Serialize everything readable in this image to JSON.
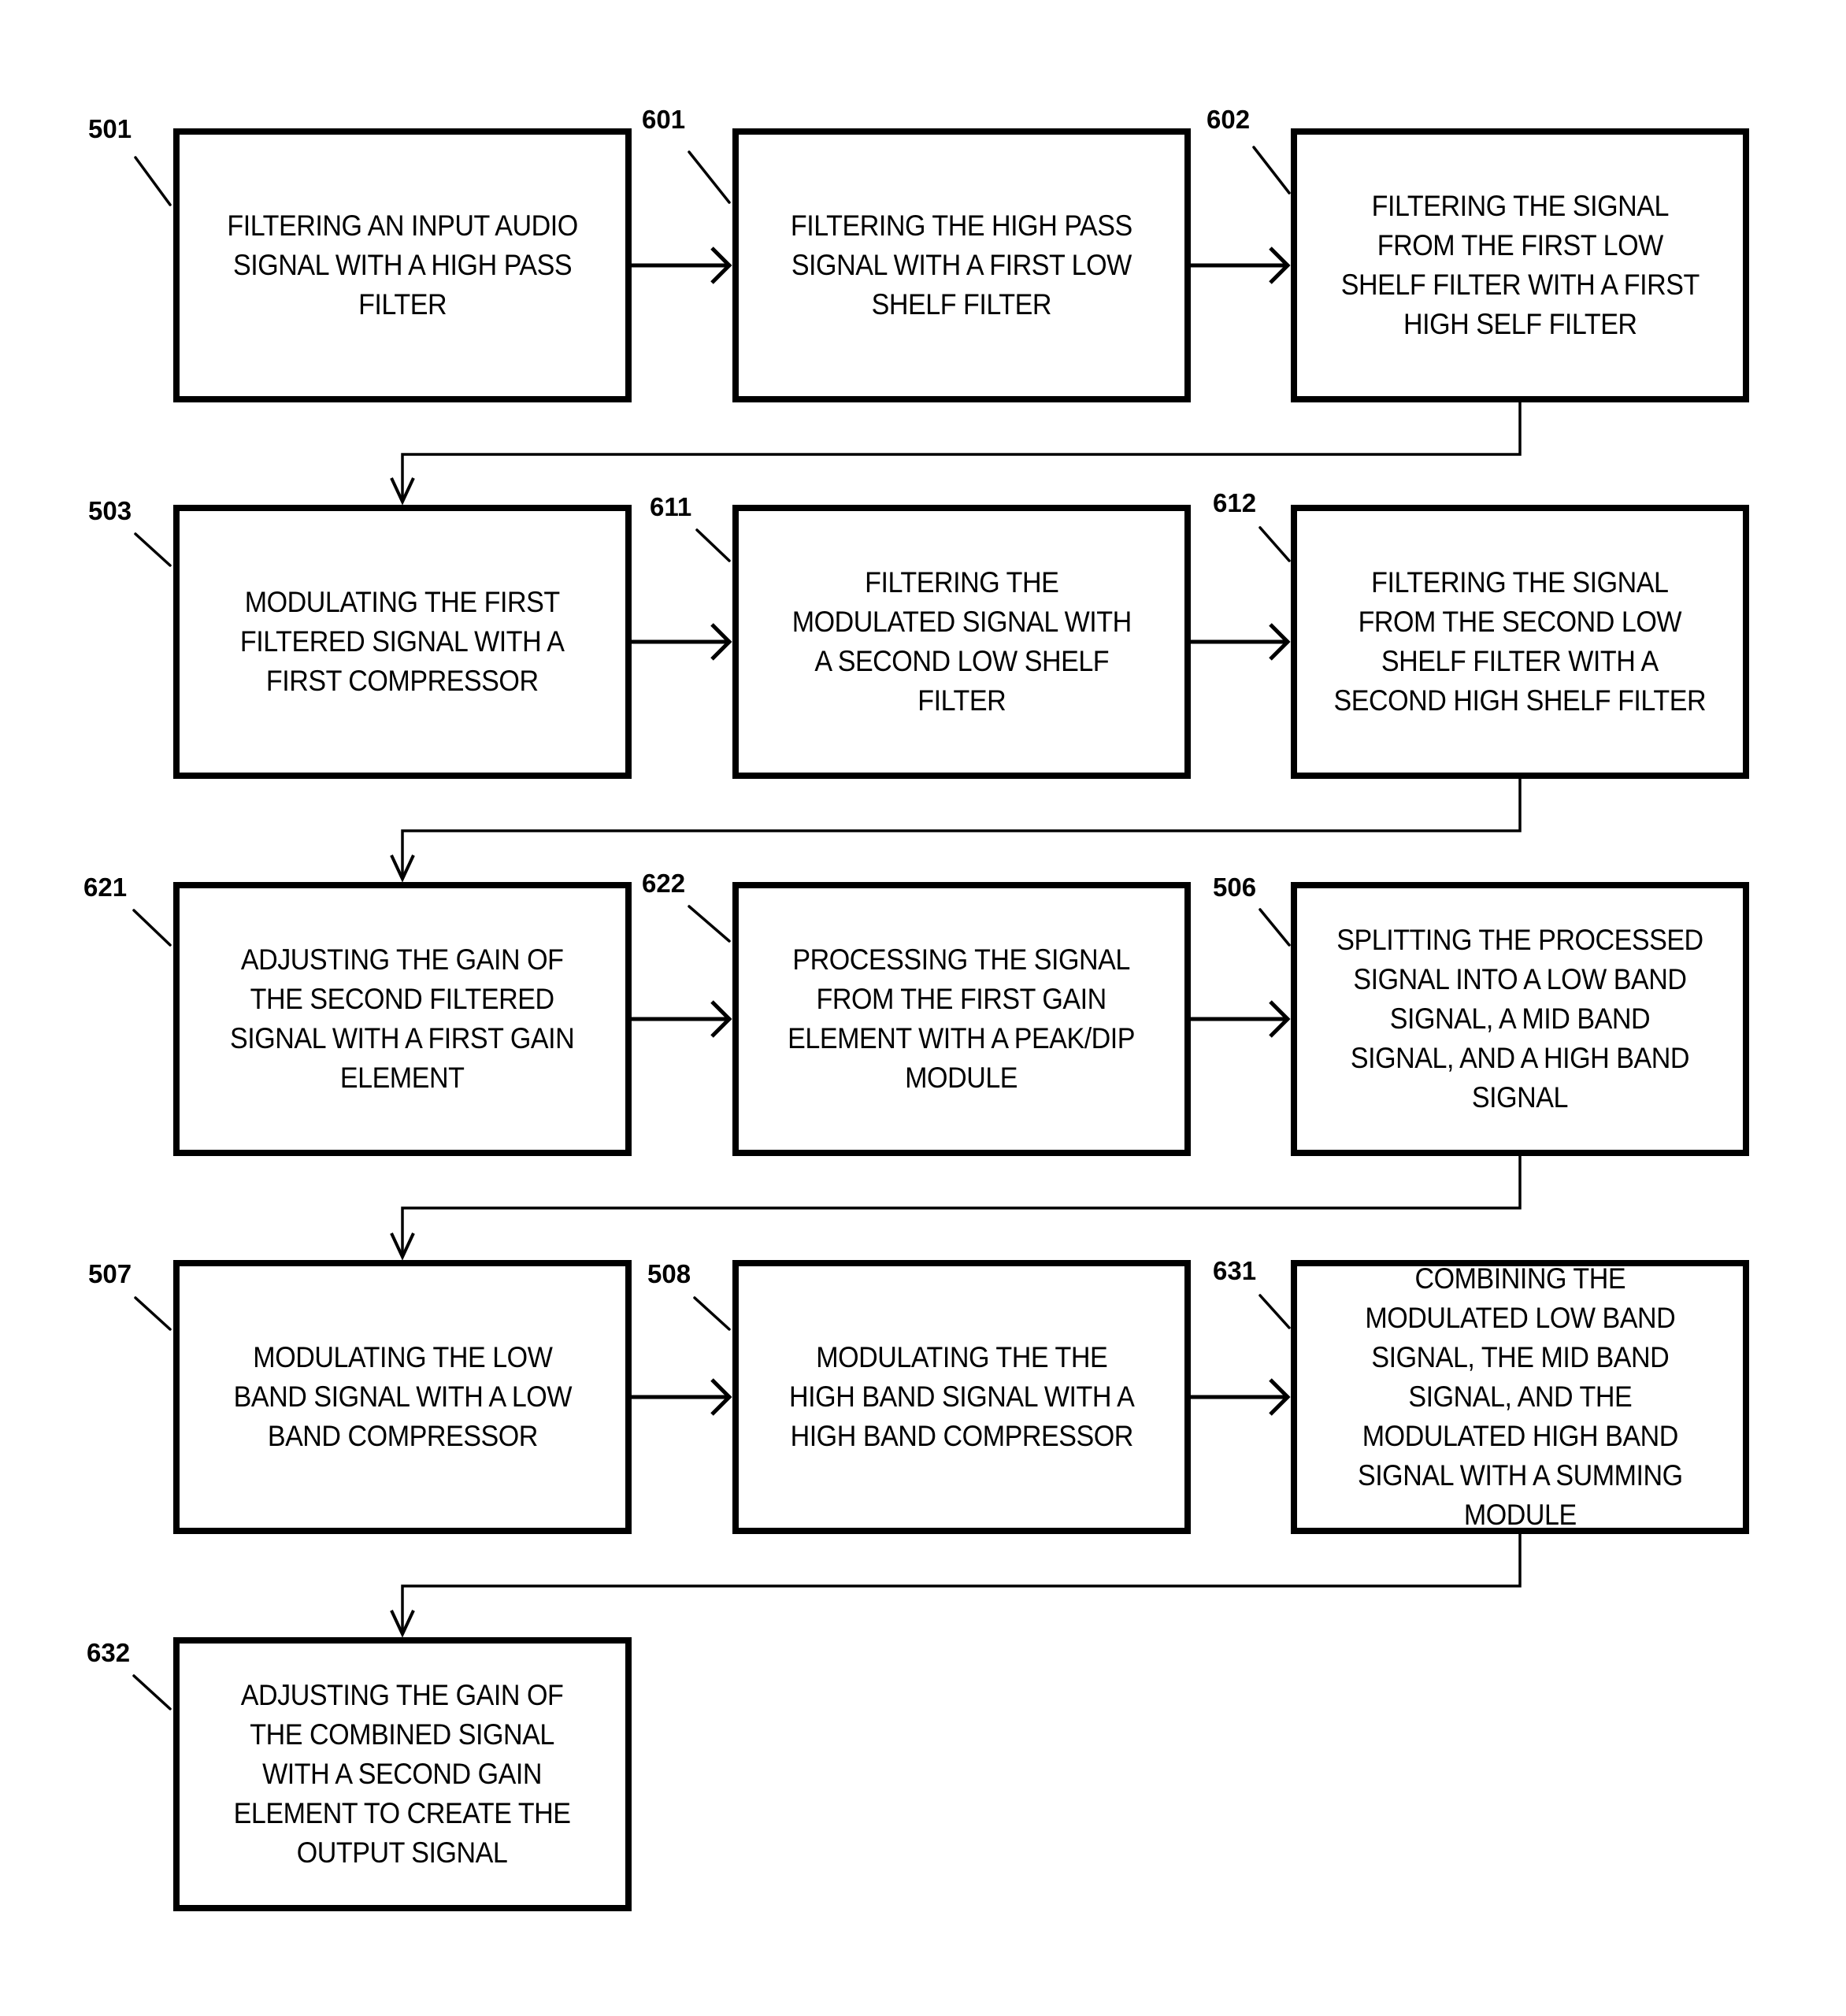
{
  "diagram": {
    "type": "flowchart",
    "steps": [
      {
        "ref": "501",
        "text": "FILTERING AN INPUT AUDIO\nSIGNAL WITH A HIGH PASS\nFILTER"
      },
      {
        "ref": "601",
        "text": "FILTERING THE HIGH PASS\nSIGNAL WITH A FIRST LOW\nSHELF FILTER"
      },
      {
        "ref": "602",
        "text": "FILTERING THE SIGNAL\nFROM THE FIRST LOW\nSHELF FILTER WITH A FIRST\nHIGH SELF FILTER"
      },
      {
        "ref": "503",
        "text": "MODULATING THE FIRST\nFILTERED SIGNAL WITH A\nFIRST COMPRESSOR"
      },
      {
        "ref": "611",
        "text": "FILTERING THE\nMODULATED SIGNAL  WITH\nA SECOND LOW SHELF\nFILTER"
      },
      {
        "ref": "612",
        "text": "FILTERING THE SIGNAL\nFROM THE SECOND LOW\nSHELF FILTER WITH A\nSECOND HIGH SHELF FILTER"
      },
      {
        "ref": "621",
        "text": "ADJUSTING THE GAIN OF\nTHE SECOND FILTERED\nSIGNAL WITH A FIRST GAIN\nELEMENT"
      },
      {
        "ref": "622",
        "text": "PROCESSING THE SIGNAL\nFROM THE FIRST GAIN\nELEMENT WITH A PEAK/DIP\nMODULE"
      },
      {
        "ref": "506",
        "text": "SPLITTING THE PROCESSED\nSIGNAL INTO A LOW BAND\nSIGNAL, A MID BAND\nSIGNAL, AND A HIGH BAND\nSIGNAL"
      },
      {
        "ref": "507",
        "text": "MODULATING THE LOW\nBAND SIGNAL WITH A LOW\nBAND COMPRESSOR"
      },
      {
        "ref": "508",
        "text": "MODULATING THE THE\nHIGH BAND SIGNAL WITH A\nHIGH BAND COMPRESSOR"
      },
      {
        "ref": "631",
        "text": "COMBINING THE\nMODULATED LOW BAND\nSIGNAL, THE MID BAND\nSIGNAL, AND THE\nMODULATED HIGH BAND\nSIGNAL WITH A SUMMING\nMODULE"
      },
      {
        "ref": "632",
        "text": "ADJUSTING THE GAIN OF\nTHE COMBINED SIGNAL\nWITH A SECOND GAIN\nELEMENT  TO CREATE THE\nOUTPUT SIGNAL"
      }
    ],
    "colors": {
      "stroke": "#000000",
      "background": "#ffffff"
    }
  }
}
